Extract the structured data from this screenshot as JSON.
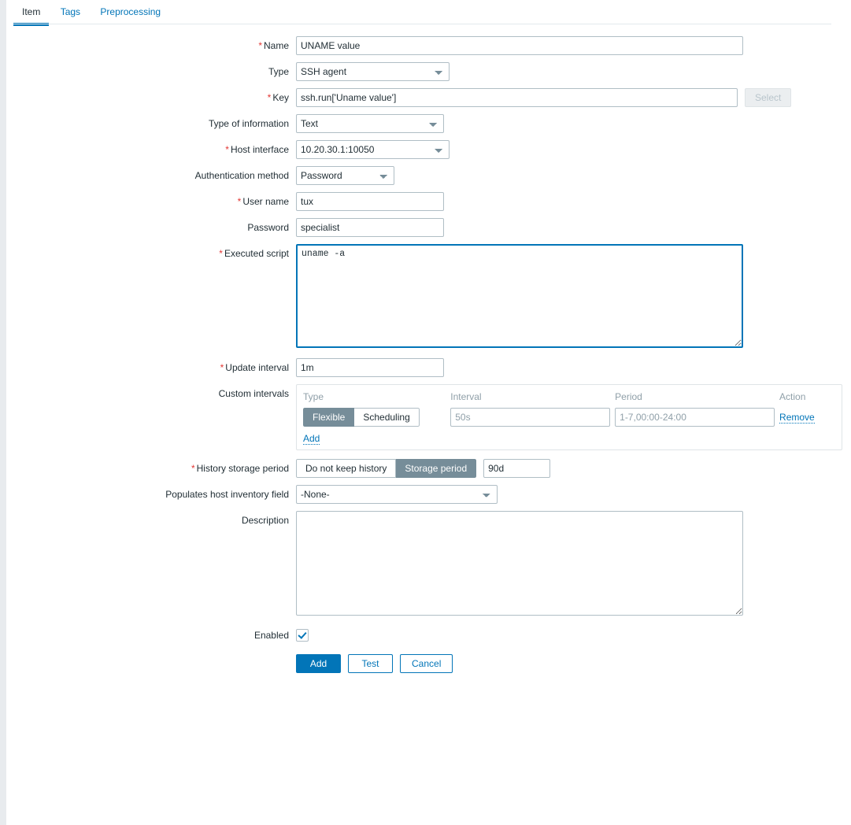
{
  "tabs": [
    {
      "label": "Item",
      "active": true
    },
    {
      "label": "Tags",
      "active": false
    },
    {
      "label": "Preprocessing",
      "active": false
    }
  ],
  "form": {
    "name": {
      "label": "Name",
      "required": true,
      "value": "UNAME value"
    },
    "type": {
      "label": "Type",
      "required": false,
      "value": "SSH agent",
      "options": [
        "SSH agent"
      ]
    },
    "key": {
      "label": "Key",
      "required": true,
      "value": "ssh.run['Uname value']",
      "select_button": "Select"
    },
    "type_of_information": {
      "label": "Type of information",
      "required": false,
      "value": "Text",
      "options": [
        "Text"
      ]
    },
    "host_interface": {
      "label": "Host interface",
      "required": true,
      "value": "10.20.30.1:10050",
      "options": [
        "10.20.30.1:10050"
      ]
    },
    "authentication_method": {
      "label": "Authentication method",
      "required": false,
      "value": "Password",
      "options": [
        "Password"
      ]
    },
    "user_name": {
      "label": "User name",
      "required": true,
      "value": "tux"
    },
    "password": {
      "label": "Password",
      "required": false,
      "value": "specialist"
    },
    "executed_script": {
      "label": "Executed script",
      "required": true,
      "value": "uname -a"
    },
    "update_interval": {
      "label": "Update interval",
      "required": true,
      "value": "1m"
    },
    "custom_intervals": {
      "label": "Custom intervals",
      "required": false,
      "columns": [
        "Type",
        "Interval",
        "Period",
        "Action"
      ],
      "rows": [
        {
          "type_options": [
            "Flexible",
            "Scheduling"
          ],
          "type_selected": "Flexible",
          "interval_value": "50s",
          "interval_placeholder": "50s",
          "period_value": "1-7,00:00-24:00",
          "period_placeholder": "1-7,00:00-24:00",
          "action_label": "Remove"
        }
      ],
      "add_label": "Add"
    },
    "history_storage_period": {
      "label": "History storage period",
      "required": true,
      "options": [
        "Do not keep history",
        "Storage period"
      ],
      "selected": "Storage period",
      "value": "90d"
    },
    "host_inventory_field": {
      "label": "Populates host inventory field",
      "required": false,
      "value": "-None-",
      "options": [
        "-None-"
      ]
    },
    "description": {
      "label": "Description",
      "required": false,
      "value": ""
    },
    "enabled": {
      "label": "Enabled",
      "checked": true
    }
  },
  "footer": {
    "add_label": "Add",
    "test_label": "Test",
    "cancel_label": "Cancel"
  },
  "colors": {
    "accent": "#0275b8",
    "required": "#e33734",
    "selected_segment": "#768d99",
    "border": "#b0bec5"
  }
}
